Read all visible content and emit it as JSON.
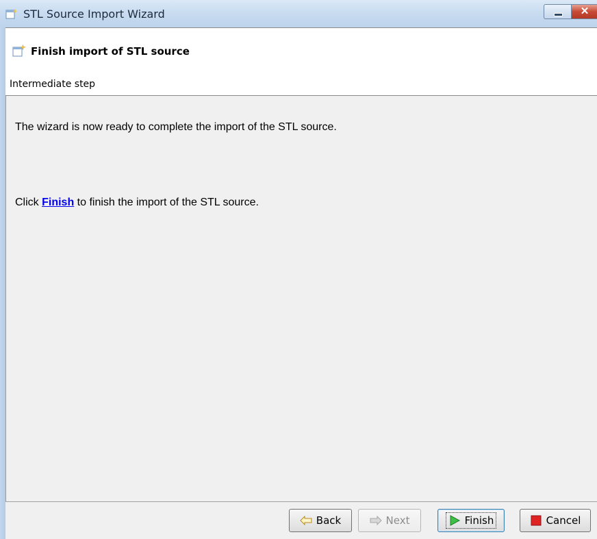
{
  "window": {
    "title": "STL Source Import Wizard",
    "close_glyph": "✕"
  },
  "header": {
    "title": "Finish import of STL source",
    "subtitle": "Intermediate step"
  },
  "content": {
    "line1": "The wizard is now ready to complete the import of the STL source.",
    "line2_prefix": "Click ",
    "line2_link": "Finish",
    "line2_suffix": " to finish the import of the STL source."
  },
  "buttons": {
    "back": "Back",
    "next": "Next",
    "finish": "Finish",
    "cancel": "Cancel"
  },
  "icons": {
    "app": "wizard-icon",
    "header": "wizard-icon",
    "back": "arrow-left-icon",
    "next": "arrow-right-icon",
    "finish": "play-icon",
    "cancel": "stop-icon"
  },
  "colors": {
    "link": "#0000ee",
    "finish_icon": "#2fa43a",
    "cancel_icon": "#d42020"
  }
}
